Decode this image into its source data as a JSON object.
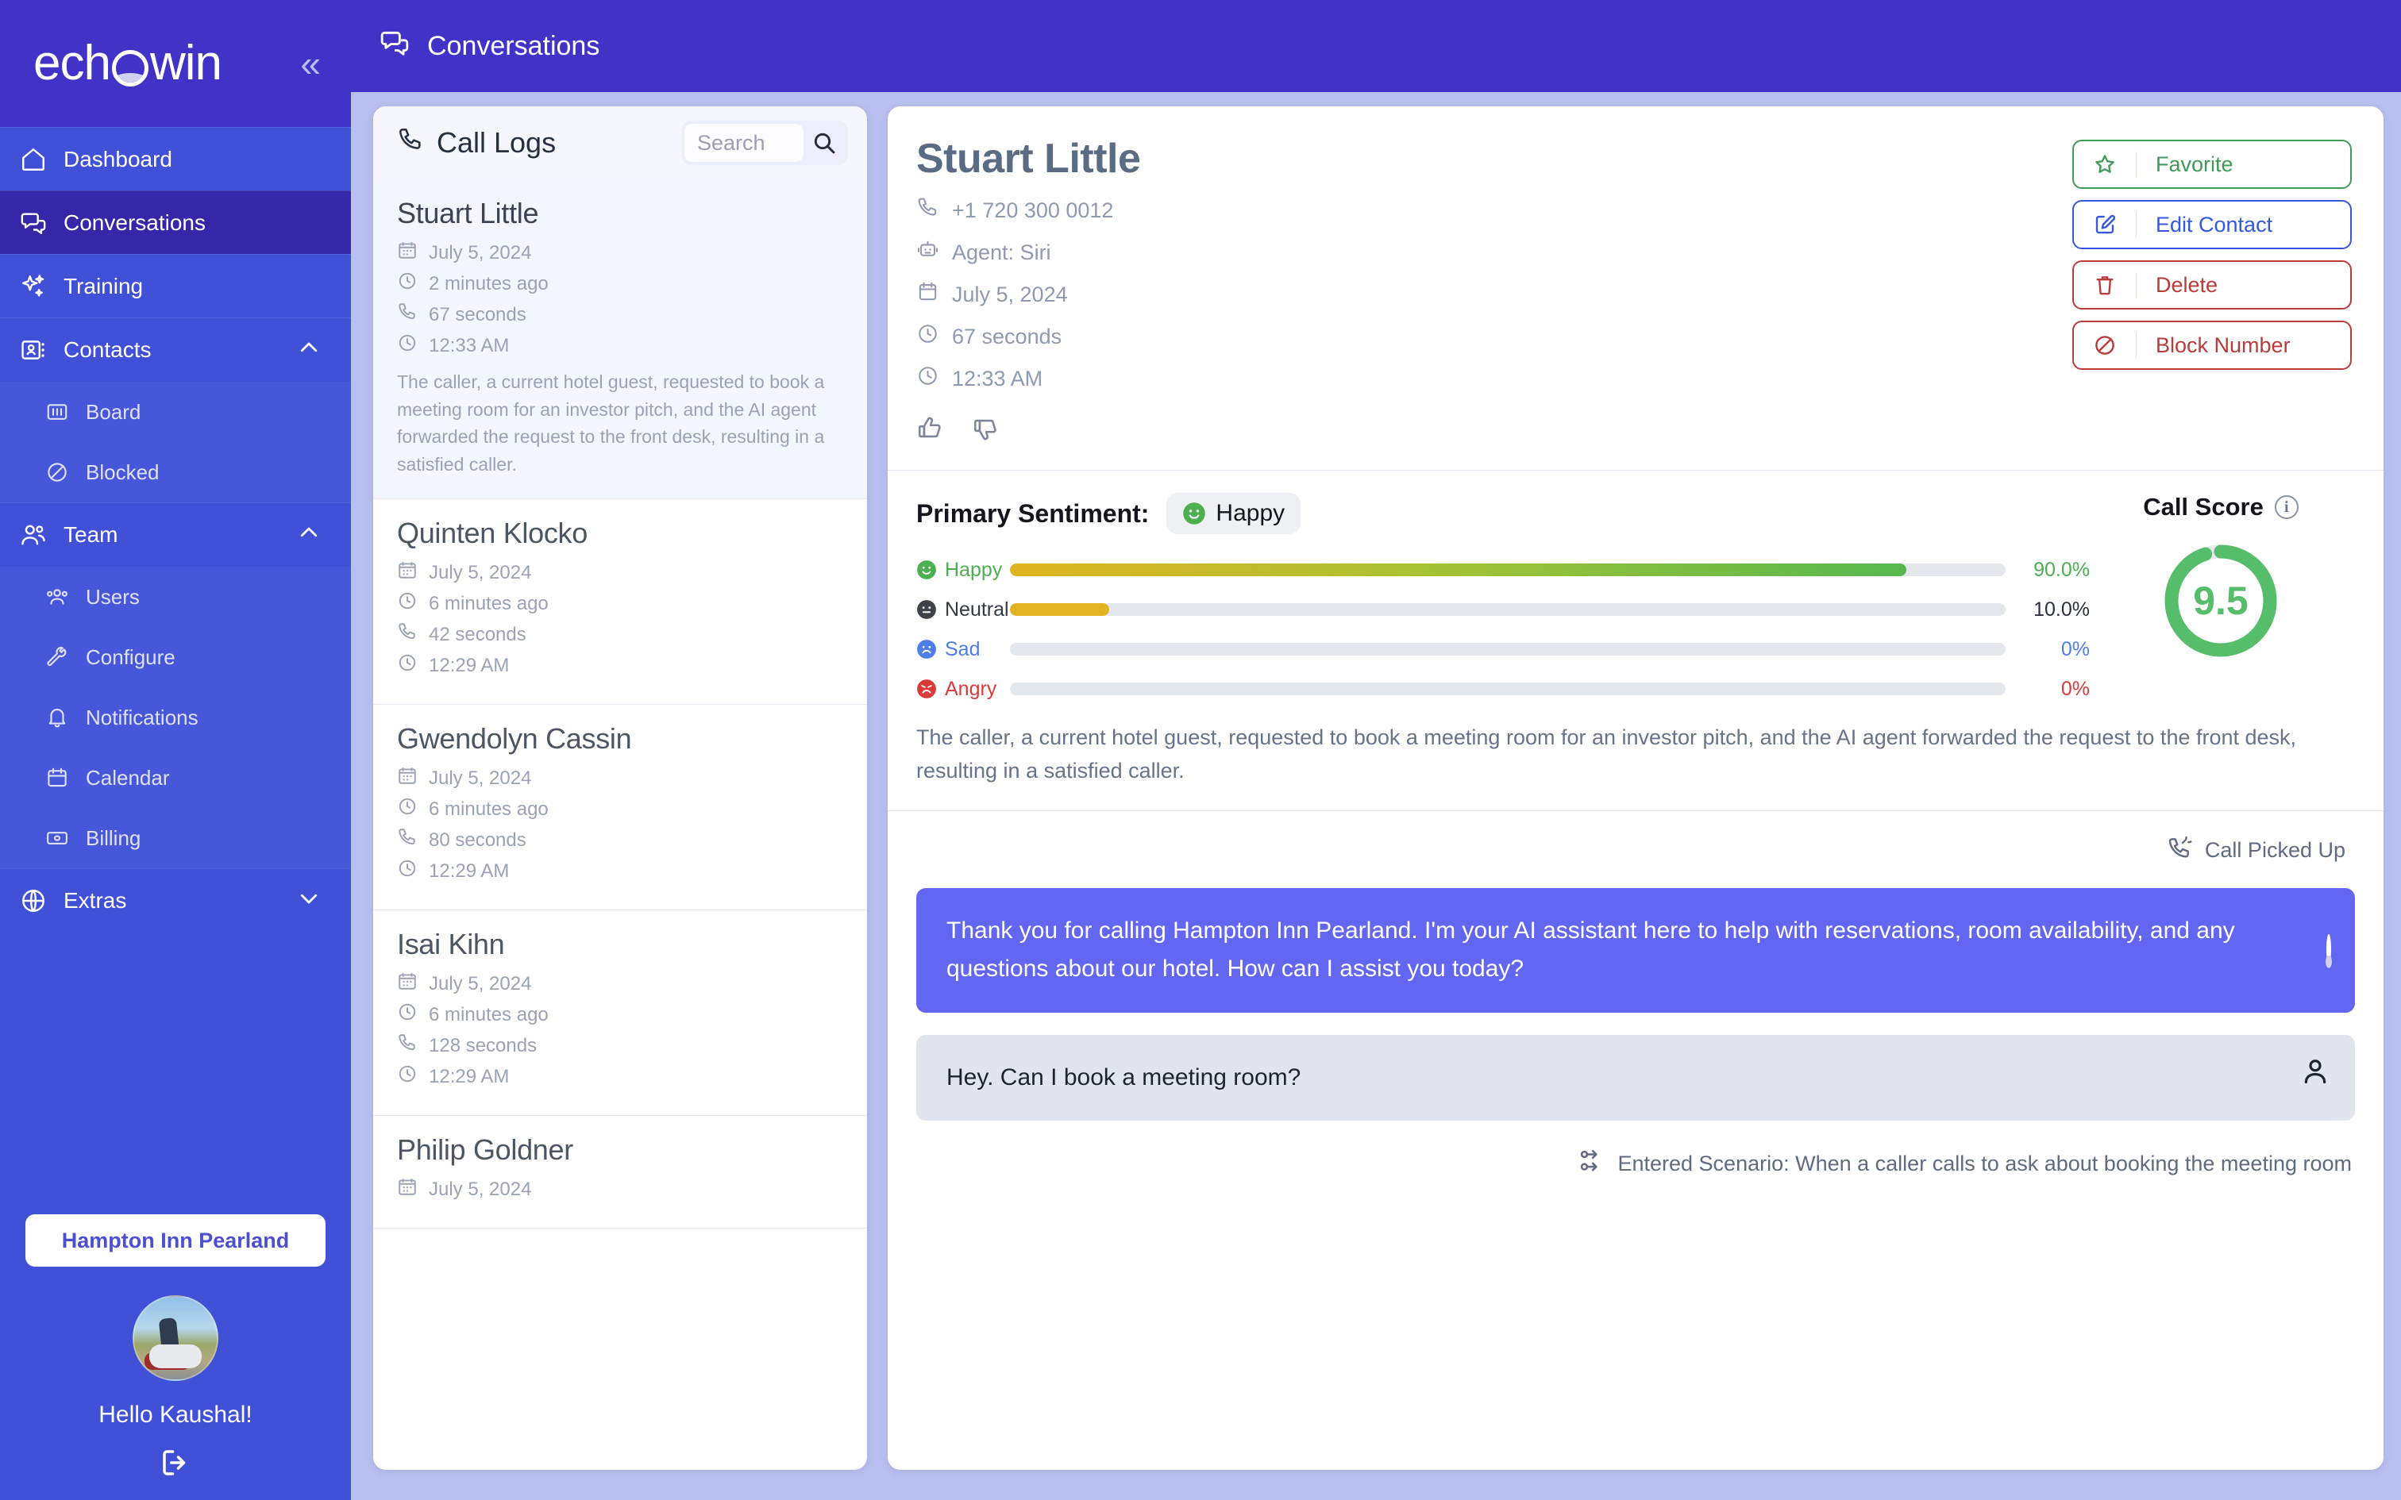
{
  "brand": {
    "name": "echowin",
    "collapse_icon": "chevrons-left-icon"
  },
  "topbar": {
    "title": "Conversations",
    "icon": "conversations-icon"
  },
  "sidebar": {
    "items": [
      {
        "label": "Dashboard",
        "icon": "home-icon",
        "active": false
      },
      {
        "label": "Conversations",
        "icon": "conversations-icon",
        "active": true
      },
      {
        "label": "Training",
        "icon": "sparkles-icon",
        "active": false
      }
    ],
    "groups": [
      {
        "label": "Contacts",
        "icon": "contact-card-icon",
        "expanded": true,
        "chevron": "chevron-up-icon",
        "children": [
          {
            "label": "Board",
            "icon": "board-icon"
          },
          {
            "label": "Blocked",
            "icon": "block-icon"
          }
        ]
      },
      {
        "label": "Team",
        "icon": "team-icon",
        "expanded": true,
        "chevron": "chevron-up-icon",
        "children": [
          {
            "label": "Users",
            "icon": "users-icon"
          },
          {
            "label": "Configure",
            "icon": "wrench-icon"
          },
          {
            "label": "Notifications",
            "icon": "bell-icon"
          },
          {
            "label": "Calendar",
            "icon": "calendar-icon"
          },
          {
            "label": "Billing",
            "icon": "billing-icon"
          }
        ]
      },
      {
        "label": "Extras",
        "icon": "globe-icon",
        "expanded": false,
        "chevron": "chevron-down-icon",
        "children": []
      }
    ],
    "org": "Hampton Inn Pearland",
    "greeting": "Hello Kaushal!",
    "logout_icon": "logout-icon"
  },
  "call_logs": {
    "title": "Call Logs",
    "title_icon": "phone-icon",
    "search_placeholder": "Search",
    "search_value": "",
    "search_icon": "search-icon",
    "items": [
      {
        "name": "Stuart Little",
        "date": "July 5, 2024",
        "relative": "2 minutes ago",
        "duration": "67 seconds",
        "time": "12:33 AM",
        "selected": true,
        "summary": "The caller, a current hotel guest, requested to book a meeting room for an investor pitch, and the AI agent forwarded the request to the front desk, resulting in a satisfied caller."
      },
      {
        "name": "Quinten Klocko",
        "date": "July 5, 2024",
        "relative": "6 minutes ago",
        "duration": "42 seconds",
        "time": "12:29 AM",
        "selected": false,
        "summary": ""
      },
      {
        "name": "Gwendolyn Cassin",
        "date": "July 5, 2024",
        "relative": "6 minutes ago",
        "duration": "80 seconds",
        "time": "12:29 AM",
        "selected": false,
        "summary": ""
      },
      {
        "name": "Isai Kihn",
        "date": "July 5, 2024",
        "relative": "6 minutes ago",
        "duration": "128 seconds",
        "time": "12:29 AM",
        "selected": false,
        "summary": ""
      },
      {
        "name": "Philip Goldner",
        "date": "July 5, 2024",
        "relative": "",
        "duration": "",
        "time": "",
        "selected": false,
        "summary": ""
      }
    ]
  },
  "detail": {
    "name": "Stuart Little",
    "phone": "+1 720 300 0012",
    "agent": "Agent: Siri",
    "date": "July 5, 2024",
    "duration": "67 seconds",
    "time": "12:33 AM",
    "thumbs_up_icon": "thumbs-up-icon",
    "thumbs_down_icon": "thumbs-down-icon",
    "actions": [
      {
        "label": "Favorite",
        "icon": "star-icon",
        "color": "#3f9b57"
      },
      {
        "label": "Edit Contact",
        "icon": "edit-icon",
        "color": "#3358e0"
      },
      {
        "label": "Delete",
        "icon": "trash-icon",
        "color": "#bb3a3a"
      },
      {
        "label": "Block Number",
        "icon": "block-icon",
        "color": "#bb3a3a"
      }
    ],
    "summary": "The caller, a current hotel guest, requested to book a meeting room for an investor pitch, and the AI agent forwarded the request to the front desk, resulting in a satisfied caller."
  },
  "sentiment": {
    "heading": "Primary Sentiment:",
    "primary": "Happy",
    "primary_emoji": "happy-face-icon",
    "rows": [
      {
        "label": "Happy",
        "pct_text": "90.0%",
        "pct": 90,
        "color": "#4caf50",
        "emoji": "happy-face-icon",
        "label_color": "#4caf50"
      },
      {
        "label": "Neutral",
        "pct_text": "10.0%",
        "pct": 10,
        "color": "#e0b422",
        "emoji": "neutral-face-icon",
        "label_color": "#333a45"
      },
      {
        "label": "Sad",
        "pct_text": "0%",
        "pct": 0,
        "color": "#4d7ee8",
        "emoji": "sad-face-icon",
        "label_color": "#4d7ee8"
      },
      {
        "label": "Angry",
        "pct_text": "0%",
        "pct": 0,
        "color": "#d93b3b",
        "emoji": "angry-face-icon",
        "label_color": "#d93b3b"
      }
    ]
  },
  "call_score": {
    "title": "Call Score",
    "info_icon": "info-icon",
    "value": "9.5",
    "max": 10,
    "color": "#56bd6b"
  },
  "transcript": {
    "status": "Call Picked Up",
    "status_icon": "call-picked-up-icon",
    "messages": [
      {
        "role": "assistant",
        "avatar_icon": "echowin-logo-icon",
        "text": "Thank you for calling Hampton Inn Pearland. I'm your AI assistant here to help with reservations, room availability, and any questions about our hotel. How can I assist you today?"
      },
      {
        "role": "user",
        "avatar_icon": "user-icon",
        "text": "Hey. Can I book a meeting room?"
      }
    ],
    "scenario": "Entered Scenario: When a caller calls to ask about booking the meeting room",
    "scenario_icon": "scenario-icon"
  },
  "chart_data": {
    "type": "bar",
    "title": "Primary Sentiment",
    "categories": [
      "Happy",
      "Neutral",
      "Sad",
      "Angry"
    ],
    "values": [
      90.0,
      10.0,
      0,
      0
    ],
    "value_labels": [
      "90.0%",
      "10.0%",
      "0%",
      "0%"
    ],
    "colors": [
      "#4caf50",
      "#e0b422",
      "#4d7ee8",
      "#d93b3b"
    ],
    "xlabel": "",
    "ylabel": "",
    "ylim": [
      0,
      100
    ],
    "orientation": "horizontal",
    "grid": false,
    "legend": false
  }
}
